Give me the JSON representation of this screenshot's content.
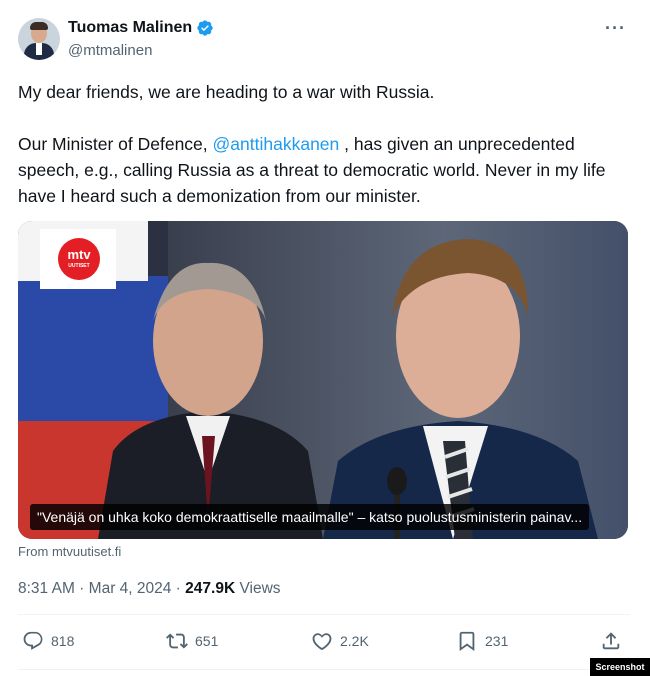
{
  "author": {
    "name": "Tuomas Malinen",
    "handle": "@mtmalinen"
  },
  "tweet": {
    "line1": "My dear friends, we are heading to a war with Russia.",
    "para2_before": "Our Minister of Defence, ",
    "mention": "@anttihakkanen",
    "para2_after": " , has given an unprecedented speech, e.g., calling Russia as a threat to democratic world. Never in my life have I heard such a demonization from our minister."
  },
  "card": {
    "logo_text": "mtv",
    "logo_sub": "UUTISET",
    "caption": "\"Venäjä on uhka koko demokraattiselle maailmalle\" – katso puolustusministerin painav...",
    "source": "From mtvuutiset.fi"
  },
  "meta": {
    "time": "8:31 AM",
    "sep1": " · ",
    "date": "Mar 4, 2024",
    "sep2": " · ",
    "views_count": "247.9K",
    "views_label": " Views"
  },
  "actions": {
    "replies": "818",
    "reposts": "651",
    "likes": "2.2K",
    "bookmarks": "231"
  },
  "icons": {
    "verified": "verified-badge-icon",
    "more": "more-icon",
    "reply": "reply-icon",
    "repost": "repost-icon",
    "like": "heart-icon",
    "bookmark": "bookmark-icon",
    "share": "share-icon"
  },
  "colors": {
    "accent": "#1d9bf0",
    "secondary_text": "#536471",
    "logo_red": "#e31e24"
  },
  "watermark": "Screenshot"
}
